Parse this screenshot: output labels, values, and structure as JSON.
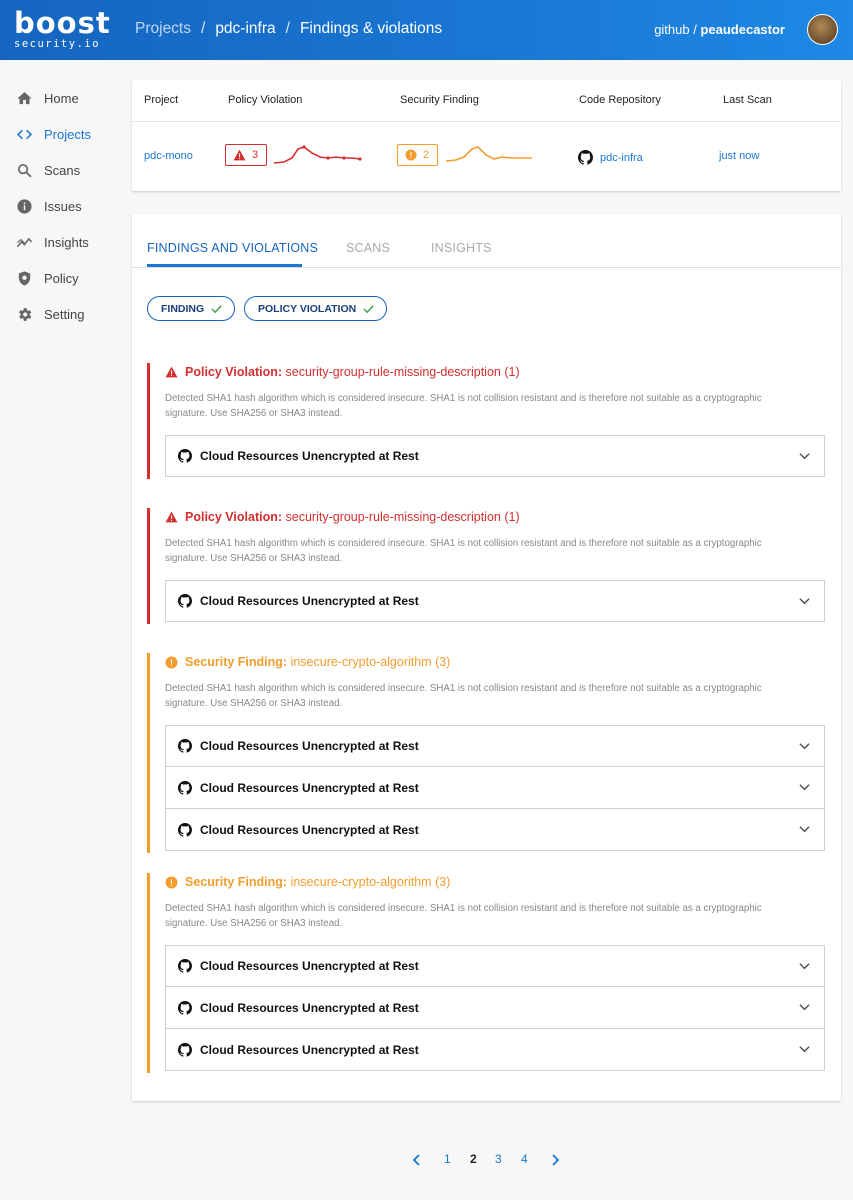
{
  "header": {
    "logo_word": "boost",
    "logo_sub": "security.io",
    "breadcrumb": [
      "Projects",
      "pdc-infra",
      "Findings & violations"
    ],
    "user_org": "github",
    "user_name": "peaudecastor"
  },
  "sidebar": {
    "items": [
      {
        "label": "Home",
        "icon": "home-icon"
      },
      {
        "label": "Projects",
        "icon": "code-icon"
      },
      {
        "label": "Scans",
        "icon": "search-icon"
      },
      {
        "label": "Issues",
        "icon": "info-icon"
      },
      {
        "label": "Insights",
        "icon": "trend-icon"
      },
      {
        "label": "Policy",
        "icon": "shield-icon"
      },
      {
        "label": "Setting",
        "icon": "gear-icon"
      }
    ],
    "active_index": 1
  },
  "project_table": {
    "headers": [
      "Project",
      "Policy Violation",
      "Security Finding",
      "Code Repository",
      "Last Scan"
    ],
    "row": {
      "project": "pdc-mono",
      "policy_violation_count": "3",
      "security_finding_count": "2",
      "repository": "pdc-infra",
      "last_scan": "just now"
    }
  },
  "tabs": [
    {
      "label": "FINDINGS AND VIOLATIONS"
    },
    {
      "label": "SCANS"
    },
    {
      "label": "INSIGHTS"
    }
  ],
  "filters": [
    {
      "label": "FINDING"
    },
    {
      "label": "POLICY VIOLATION"
    }
  ],
  "findings": [
    {
      "kind": "Policy Violation:",
      "name": "security-group-rule-missing-description (1)",
      "severity": "violation",
      "description": "Detected SHA1 hash algorithm which is considered insecure. SHA1 is not collision resistant and is therefore not suitable as a cryptographic signature. Use SHA256 or SHA3 instead.",
      "repos": [
        "Cloud Resources Unencrypted at Rest"
      ]
    },
    {
      "kind": "Policy Violation:",
      "name": "security-group-rule-missing-description (1)",
      "severity": "violation",
      "description": "Detected SHA1 hash algorithm which is considered insecure. SHA1 is not collision resistant and is therefore not suitable as a cryptographic signature. Use SHA256 or SHA3 instead.",
      "repos": [
        "Cloud Resources Unencrypted at Rest"
      ]
    },
    {
      "kind": "Security Finding:",
      "name": "insecure-crypto-algorithm (3)",
      "severity": "finding",
      "description": "Detected SHA1 hash algorithm which is considered insecure. SHA1 is not collision resistant and is therefore not suitable as a cryptographic signature. Use SHA256 or SHA3 instead.",
      "repos": [
        "Cloud Resources Unencrypted at Rest",
        "Cloud Resources Unencrypted at Rest",
        "Cloud Resources Unencrypted at Rest"
      ]
    },
    {
      "kind": "Security Finding:",
      "name": "insecure-crypto-algorithm (3)",
      "severity": "finding",
      "description": "Detected SHA1 hash algorithm which is considered insecure. SHA1 is not collision resistant and is therefore not suitable as a cryptographic signature. Use SHA256 or SHA3 instead.",
      "repos": [
        "Cloud Resources Unencrypted at Rest",
        "Cloud Resources Unencrypted at Rest",
        "Cloud Resources Unencrypted at Rest"
      ]
    }
  ],
  "pagination": {
    "pages": [
      "1",
      "2",
      "3",
      "4"
    ],
    "current": "2"
  },
  "colors": {
    "brand": "#1976d2",
    "violation": "#d32f2f",
    "finding": "#f29d2e"
  }
}
